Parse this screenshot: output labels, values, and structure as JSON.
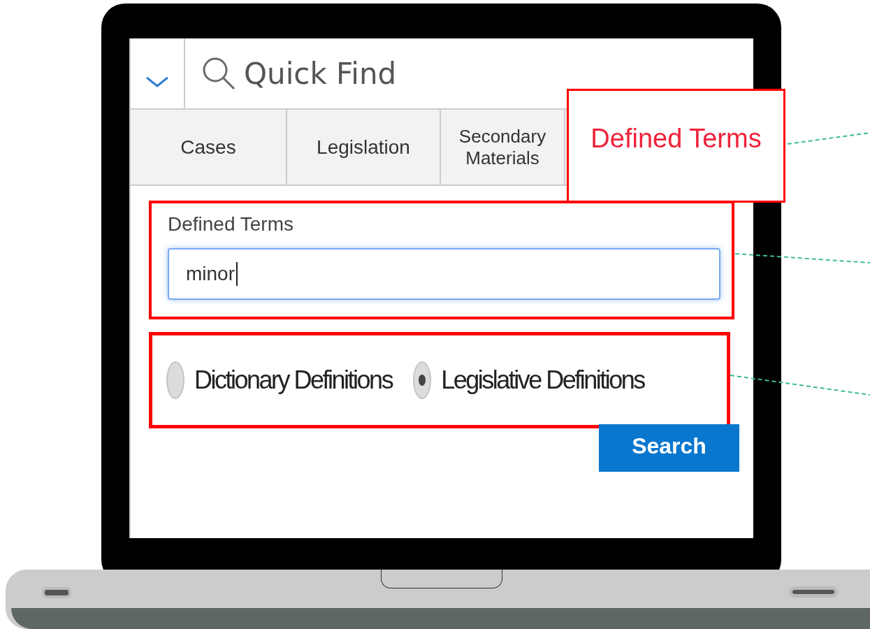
{
  "header": {
    "title": "Quick Find"
  },
  "tabs": [
    {
      "label": "Cases",
      "selected": false
    },
    {
      "label": "Legislation",
      "selected": false
    },
    {
      "label": "Secondary Materials",
      "selected": false
    },
    {
      "label": "Defined Terms",
      "selected": true
    }
  ],
  "field": {
    "label": "Defined Terms",
    "value": "minor"
  },
  "options": [
    {
      "label": "Dictionary Definitions",
      "selected": false
    },
    {
      "label": "Legislative Definitions",
      "selected": true
    }
  ],
  "button": "Search"
}
